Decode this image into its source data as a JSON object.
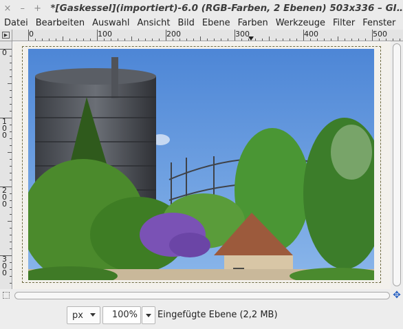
{
  "titlebar": {
    "close_glyph": "×",
    "minimize_glyph": "–",
    "maximize_glyph": "+",
    "title": "*[Gaskessel](importiert)-6.0 (RGB-Farben, 2 Ebenen) 503x336 – GI…"
  },
  "menu": {
    "items": [
      "Datei",
      "Bearbeiten",
      "Auswahl",
      "Ansicht",
      "Bild",
      "Ebene",
      "Farben",
      "Werkzeuge",
      "Filter",
      "Fenster"
    ]
  },
  "rulers": {
    "top_labels": [
      "0",
      "100",
      "200",
      "300",
      "400",
      "500"
    ],
    "left_labels": [
      "0",
      "100",
      "200",
      "300"
    ],
    "corner_glyph": "▶"
  },
  "statusbar": {
    "unit": "px",
    "zoom": "100%",
    "status": "Eingefügte Ebene (2,2 MB)"
  },
  "colors": {
    "chrome": "#ebebeb",
    "canvas_bg": "#f3f1ec",
    "sky": "#6f9fdf",
    "accent_navigate": "#2a63c4"
  },
  "icons": {
    "navigate": "navigate-icon",
    "quick_mask": "quick-mask-icon",
    "ruler_menu": "ruler-menu-icon"
  }
}
